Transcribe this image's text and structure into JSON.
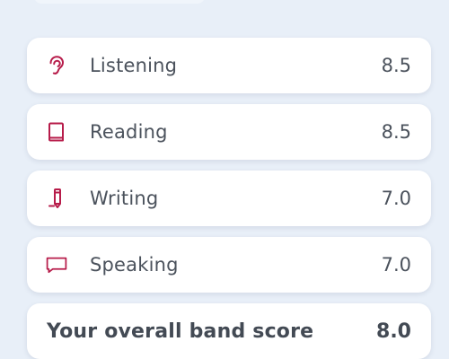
{
  "colors": {
    "background": "#e8eff8",
    "card": "#ffffff",
    "text": "#4b525c",
    "accent": "#b71c4a"
  },
  "results": [
    {
      "icon": "ear-icon",
      "label": "Listening",
      "score": "8.5"
    },
    {
      "icon": "book-icon",
      "label": "Reading",
      "score": "8.5"
    },
    {
      "icon": "pencil-icon",
      "label": "Writing",
      "score": "7.0"
    },
    {
      "icon": "speech-bubble-icon",
      "label": "Speaking",
      "score": "7.0"
    }
  ],
  "overall": {
    "label": "Your overall band score",
    "score": "8.0"
  }
}
